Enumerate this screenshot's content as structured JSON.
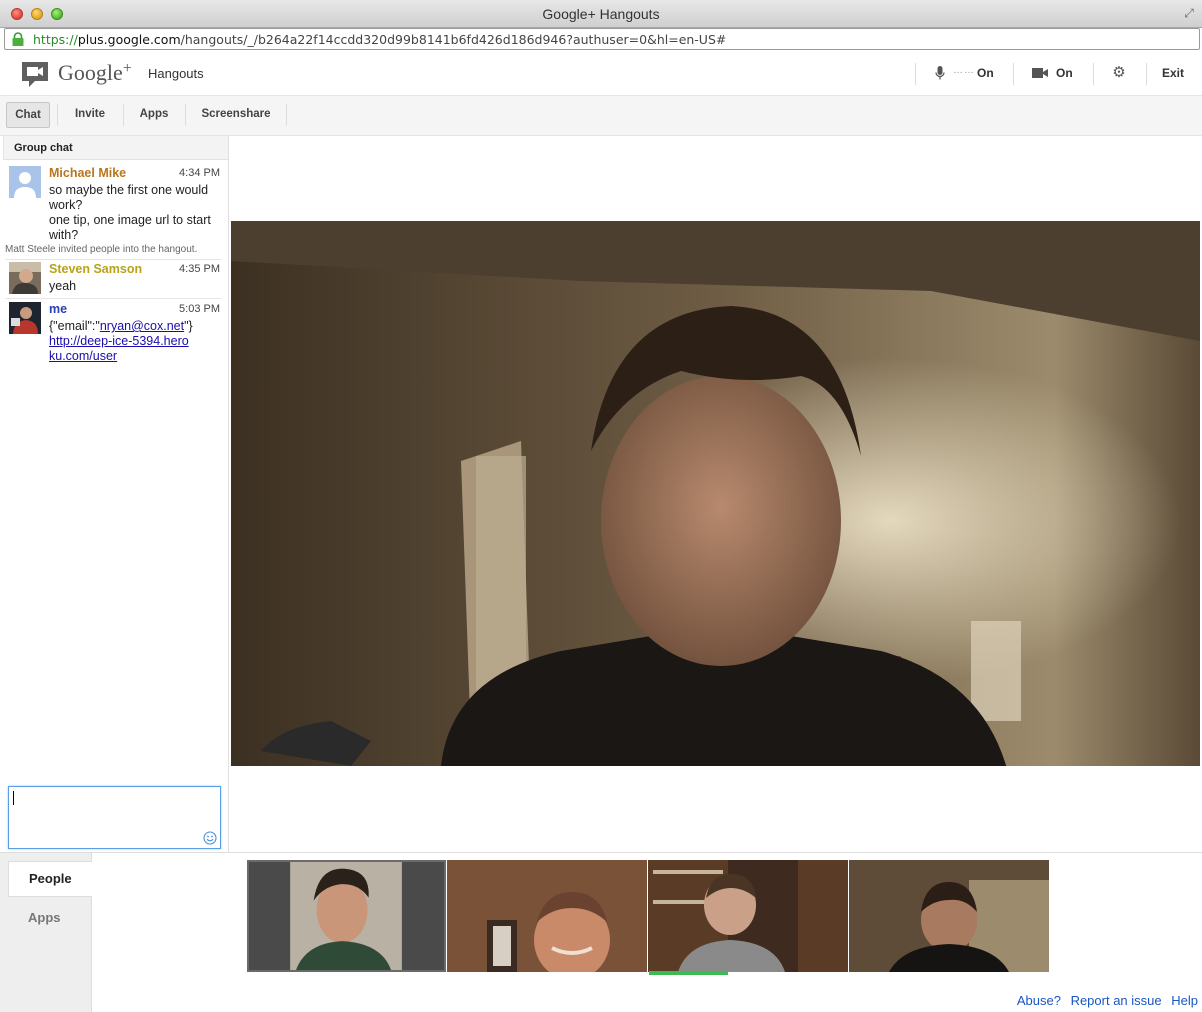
{
  "window": {
    "title": "Google+ Hangouts",
    "url_scheme": "https://",
    "url_host": "plus.google.com",
    "url_path": "/hangouts/_/b264a22f14ccdd320d99b8141b6fd426d186d946?authuser=0&hl=en-US#"
  },
  "header": {
    "brand": "Google",
    "brand_plus": "+",
    "product": "Hangouts",
    "mic_level": "……",
    "mic_status": "On",
    "camera_status": "On",
    "exit_label": "Exit"
  },
  "toolbar": {
    "tabs": [
      {
        "label": "Chat"
      },
      {
        "label": "Invite"
      },
      {
        "label": "Apps"
      },
      {
        "label": "Screenshare"
      }
    ]
  },
  "chat": {
    "header": "Group chat",
    "messages": [
      {
        "sender": "Michael Mike",
        "color": "#b8761e",
        "time": "4:34 PM",
        "lines": [
          "so maybe the first one would work?",
          "one tip, one image url to start with?"
        ]
      },
      {
        "sender": "Steven Samson",
        "color": "#b8a21a",
        "time": "4:35 PM",
        "lines": [
          "yeah"
        ]
      },
      {
        "sender": "me",
        "color": "#2b3fb5",
        "time": "5:03 PM",
        "line_prefix": "{\"email\":\"",
        "email": "nryan@cox.net",
        "line_suffix": "\"}",
        "link": "http://deep-ice-5394.heroku.com/user"
      }
    ],
    "system_note": "Matt Steele invited people into the hangout.",
    "input_value": ""
  },
  "bottom": {
    "tabs": [
      {
        "label": "People"
      },
      {
        "label": "Apps"
      }
    ],
    "footer_links": [
      "Abuse?",
      "Report an issue",
      "Help"
    ]
  }
}
